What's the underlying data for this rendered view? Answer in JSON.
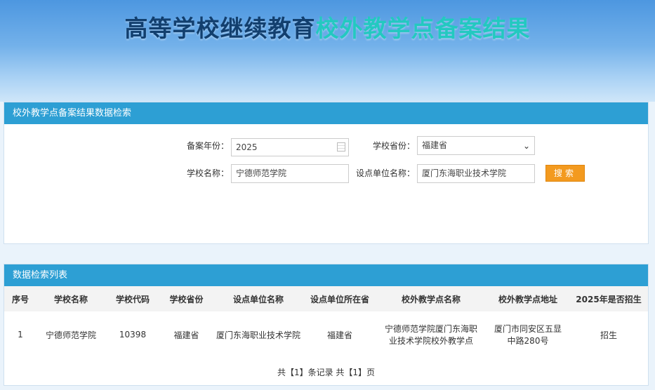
{
  "hero": {
    "title_part1": "高等学校继续教育",
    "title_part2": "校外教学点备案结果"
  },
  "search": {
    "header": "校外教学点备案结果数据检索",
    "year_label": "备案年份：",
    "year_value": "2025",
    "province_label": "学校省份：",
    "province_value": "福建省",
    "school_label": "学校名称：",
    "school_value": "宁德师范学院",
    "unit_label": "设点单位名称：",
    "unit_value": "厦门东海职业技术学院",
    "search_button": "搜索"
  },
  "list": {
    "header": "数据检索列表",
    "columns": [
      "序号",
      "学校名称",
      "学校代码",
      "学校省份",
      "设点单位名称",
      "设点单位所在省",
      "校外教学点名称",
      "校外教学点地址",
      "2025年是否招生"
    ],
    "rows": [
      [
        "1",
        "宁德师范学院",
        "10398",
        "福建省",
        "厦门东海职业技术学院",
        "福建省",
        "宁德师范学院厦门东海职业技术学院校外教学点",
        "厦门市同安区五显中路280号",
        "招生"
      ]
    ],
    "pager": "共【1】条记录 共【1】页"
  }
}
